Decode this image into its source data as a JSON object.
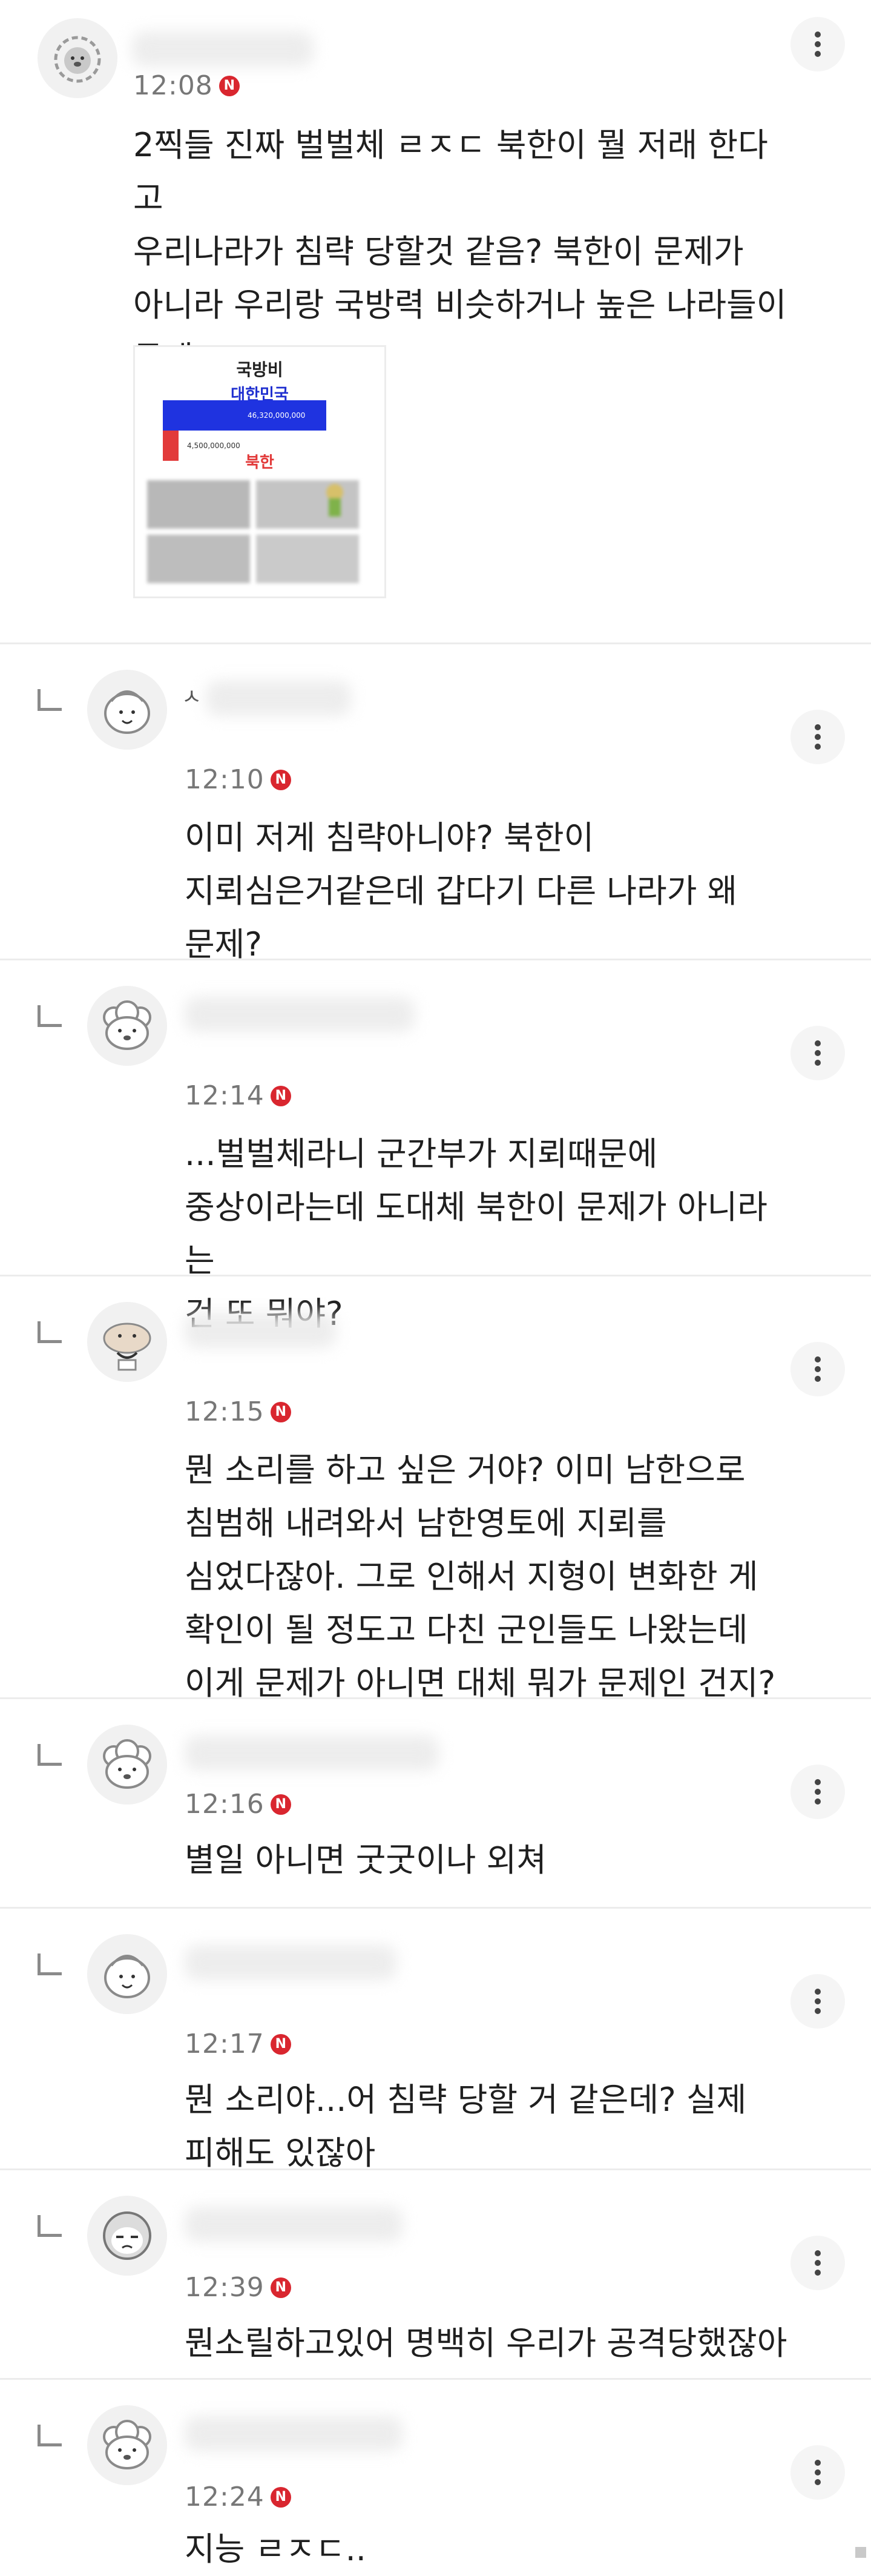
{
  "comments": [
    {
      "time": "12:08",
      "badge": "N",
      "text": "2찍들 진짜 벌벌체 ㄹㅈㄷ 북한이 뭘 저래 한다고\n우리나라가 침략 당할것 같음? 북한이 문제가\n아니라 우리랑 국방력 비슷하거나 높은 나라들이\n문제",
      "attachment": {
        "title": "국방비",
        "country_a": "대한민국",
        "value_a": "46,320,000,000",
        "value_b": "4,500,000,000",
        "country_b": "북한"
      }
    },
    {
      "name": "ㅅ",
      "time": "12:10",
      "badge": "N",
      "text": "이미 저게 침략아니야? 북한이\n지뢰심은거같은데 갑다기 다른 나라가 왜\n문제?"
    },
    {
      "time": "12:14",
      "badge": "N",
      "text": "...벌벌체라니 군간부가 지뢰때문에\n중상이라는데 도대체 북한이 문제가 아니라는\n건 또 뭐야?"
    },
    {
      "time": "12:15",
      "badge": "N",
      "text": "뭔 소리를 하고 싶은 거야? 이미 남한으로\n침범해 내려와서 남한영토에 지뢰를\n심었다잖아. 그로 인해서 지형이 변화한 게\n확인이 될 정도고 다친 군인들도 나왔는데\n이게 문제가 아니면 대체 뭐가 문제인 건지?"
    },
    {
      "time": "12:16",
      "badge": "N",
      "text": "별일 아니면 굿굿이나 외쳐"
    },
    {
      "time": "12:17",
      "badge": "N",
      "text": "뭔 소리야...어 침략 당할 거 같은데? 실제\n피해도 있잖아"
    },
    {
      "time": "12:39",
      "badge": "N",
      "text": "뭔소릴하고있어 명백히 우리가 공격당했잖아"
    },
    {
      "time": "12:24",
      "badge": "N",
      "text": "지능 ㄹㅈㄷ.."
    }
  ]
}
